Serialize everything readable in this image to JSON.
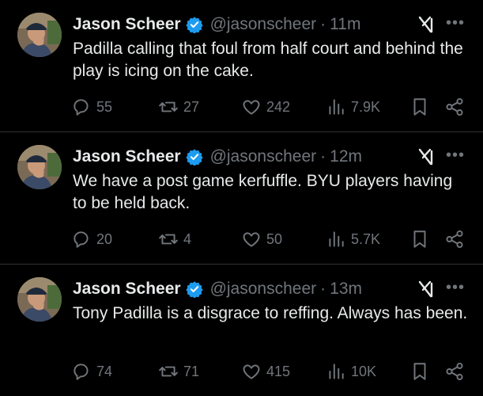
{
  "tweets": [
    {
      "name": "Jason Scheer",
      "handle": "@jasonscheer",
      "separator": "·",
      "time": "11m",
      "text": "Padilla calling that foul from half court and behind the play is icing on the cake.",
      "replies": "55",
      "retweets": "27",
      "likes": "242",
      "views": "7.9K"
    },
    {
      "name": "Jason Scheer",
      "handle": "@jasonscheer",
      "separator": "·",
      "time": "12m",
      "text": "We have a post game kerfuffle. BYU players having to be held back.",
      "replies": "20",
      "retweets": "4",
      "likes": "50",
      "views": "5.7K"
    },
    {
      "name": "Jason Scheer",
      "handle": "@jasonscheer",
      "separator": "·",
      "time": "13m",
      "text": "Tony Padilla is a disgrace to reffing. Always has been.",
      "replies": "74",
      "retweets": "71",
      "likes": "415",
      "views": "10K"
    }
  ],
  "icons": {
    "verified": "verified-badge-icon",
    "grok": "grok-icon",
    "more": "more-icon",
    "reply": "reply-icon",
    "retweet": "retweet-icon",
    "like": "heart-icon",
    "views": "views-icon",
    "bookmark": "bookmark-icon",
    "share": "share-icon"
  },
  "colors": {
    "background": "#000000",
    "text": "#e7e9ea",
    "muted": "#71767b",
    "verified": "#1d9bf0",
    "divider": "#2f3336"
  }
}
